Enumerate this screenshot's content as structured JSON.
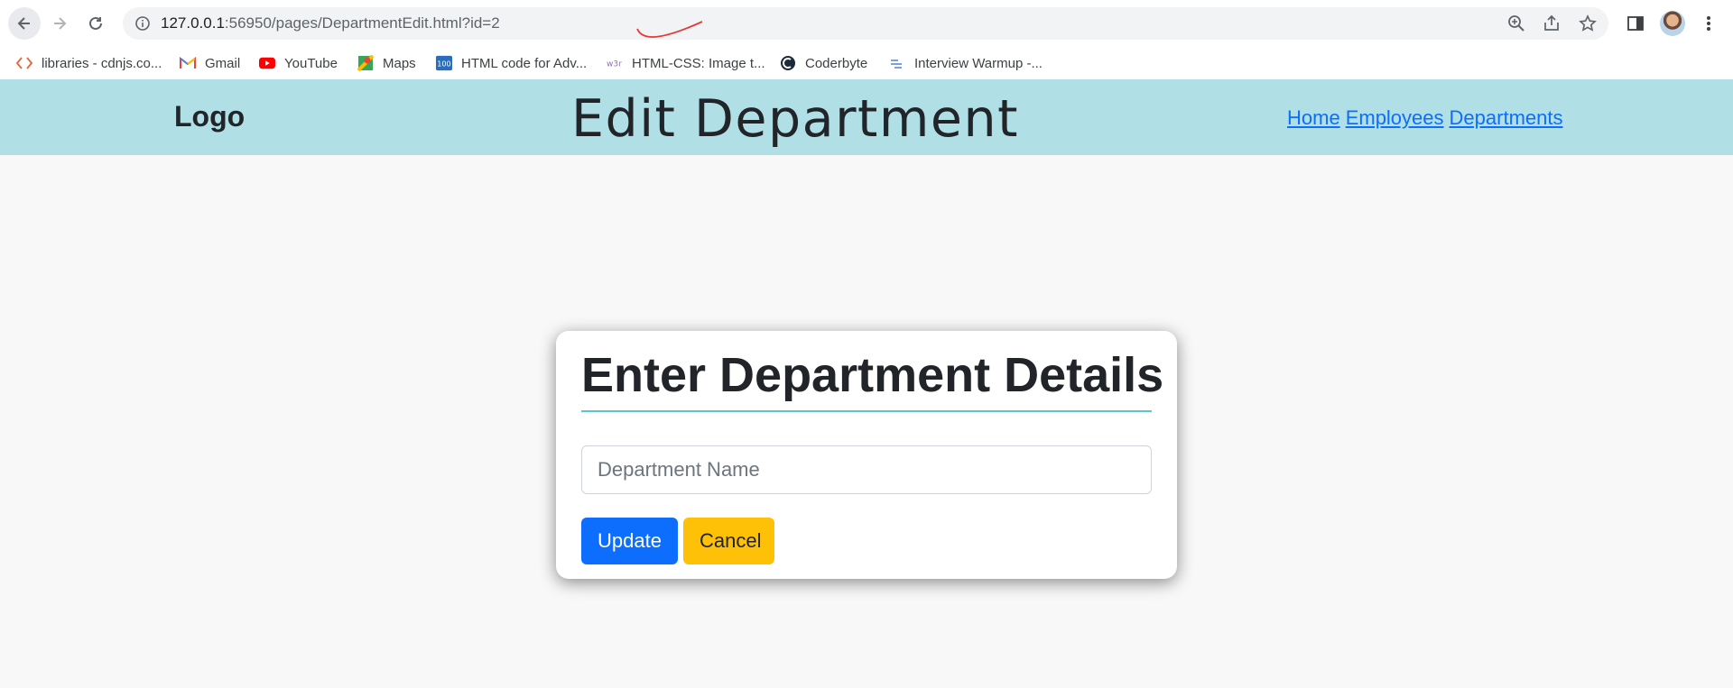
{
  "browser": {
    "url_host": "127.0.0.1",
    "url_rest": ":56950/pages/DepartmentEdit.html?id=2",
    "bookmarks": [
      {
        "label": "libraries - cdnjs.co...",
        "icon": "code-brackets-icon"
      },
      {
        "label": "Gmail",
        "icon": "gmail-icon"
      },
      {
        "label": "YouTube",
        "icon": "youtube-icon"
      },
      {
        "label": "Maps",
        "icon": "maps-icon"
      },
      {
        "label": "HTML code for Adv...",
        "icon": "100-badge-icon"
      },
      {
        "label": "HTML-CSS: Image t...",
        "icon": "w3r-icon"
      },
      {
        "label": "Coderbyte",
        "icon": "coderbyte-icon"
      },
      {
        "label": "Interview Warmup -...",
        "icon": "warmup-icon"
      }
    ]
  },
  "header": {
    "logo": "Logo",
    "title": "Edit Department",
    "nav": [
      "Home",
      "Employees",
      "Departments"
    ]
  },
  "form": {
    "heading": "Enter Department Details",
    "input_placeholder": "Department Name",
    "input_value": "",
    "update_label": "Update",
    "cancel_label": "Cancel"
  },
  "colors": {
    "header_bg": "#b1dfe6",
    "primary": "#0d6efd",
    "warning": "#ffc107",
    "underline_accent": "#5cc6cf"
  }
}
